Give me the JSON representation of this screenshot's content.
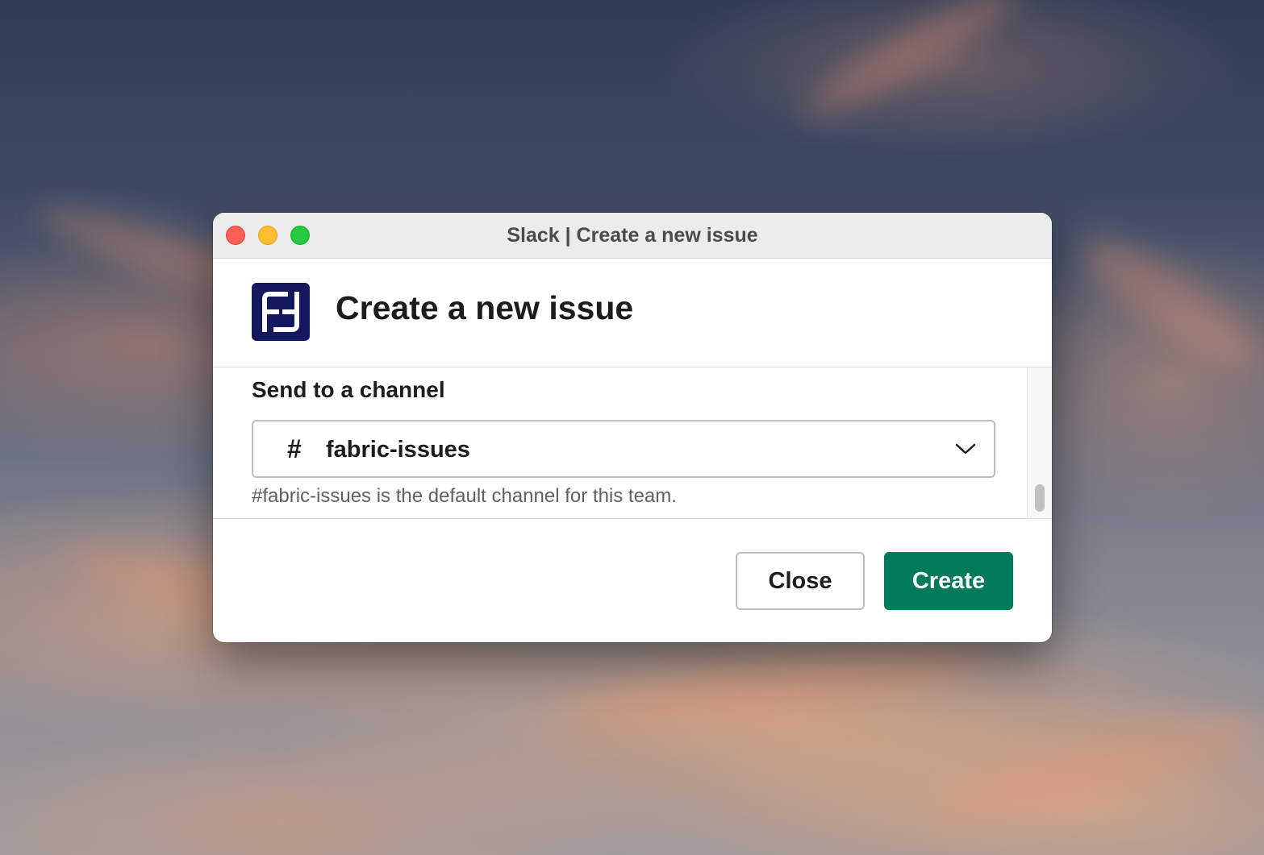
{
  "window": {
    "title": "Slack | Create a new issue"
  },
  "modal": {
    "title": "Create a new issue",
    "app_icon": "fabric-logo-icon"
  },
  "field": {
    "label": "Send to a channel",
    "channel_prefix": "#",
    "selected_channel": "fabric-issues",
    "hint": "#fabric-issues is the default channel for this team."
  },
  "buttons": {
    "close_label": "Close",
    "create_label": "Create"
  },
  "colors": {
    "create_button": "#007a5a",
    "app_logo_bg": "#14195f",
    "traffic_close": "#fe5f57",
    "traffic_minimize": "#febc2e",
    "traffic_zoom": "#28c840"
  }
}
